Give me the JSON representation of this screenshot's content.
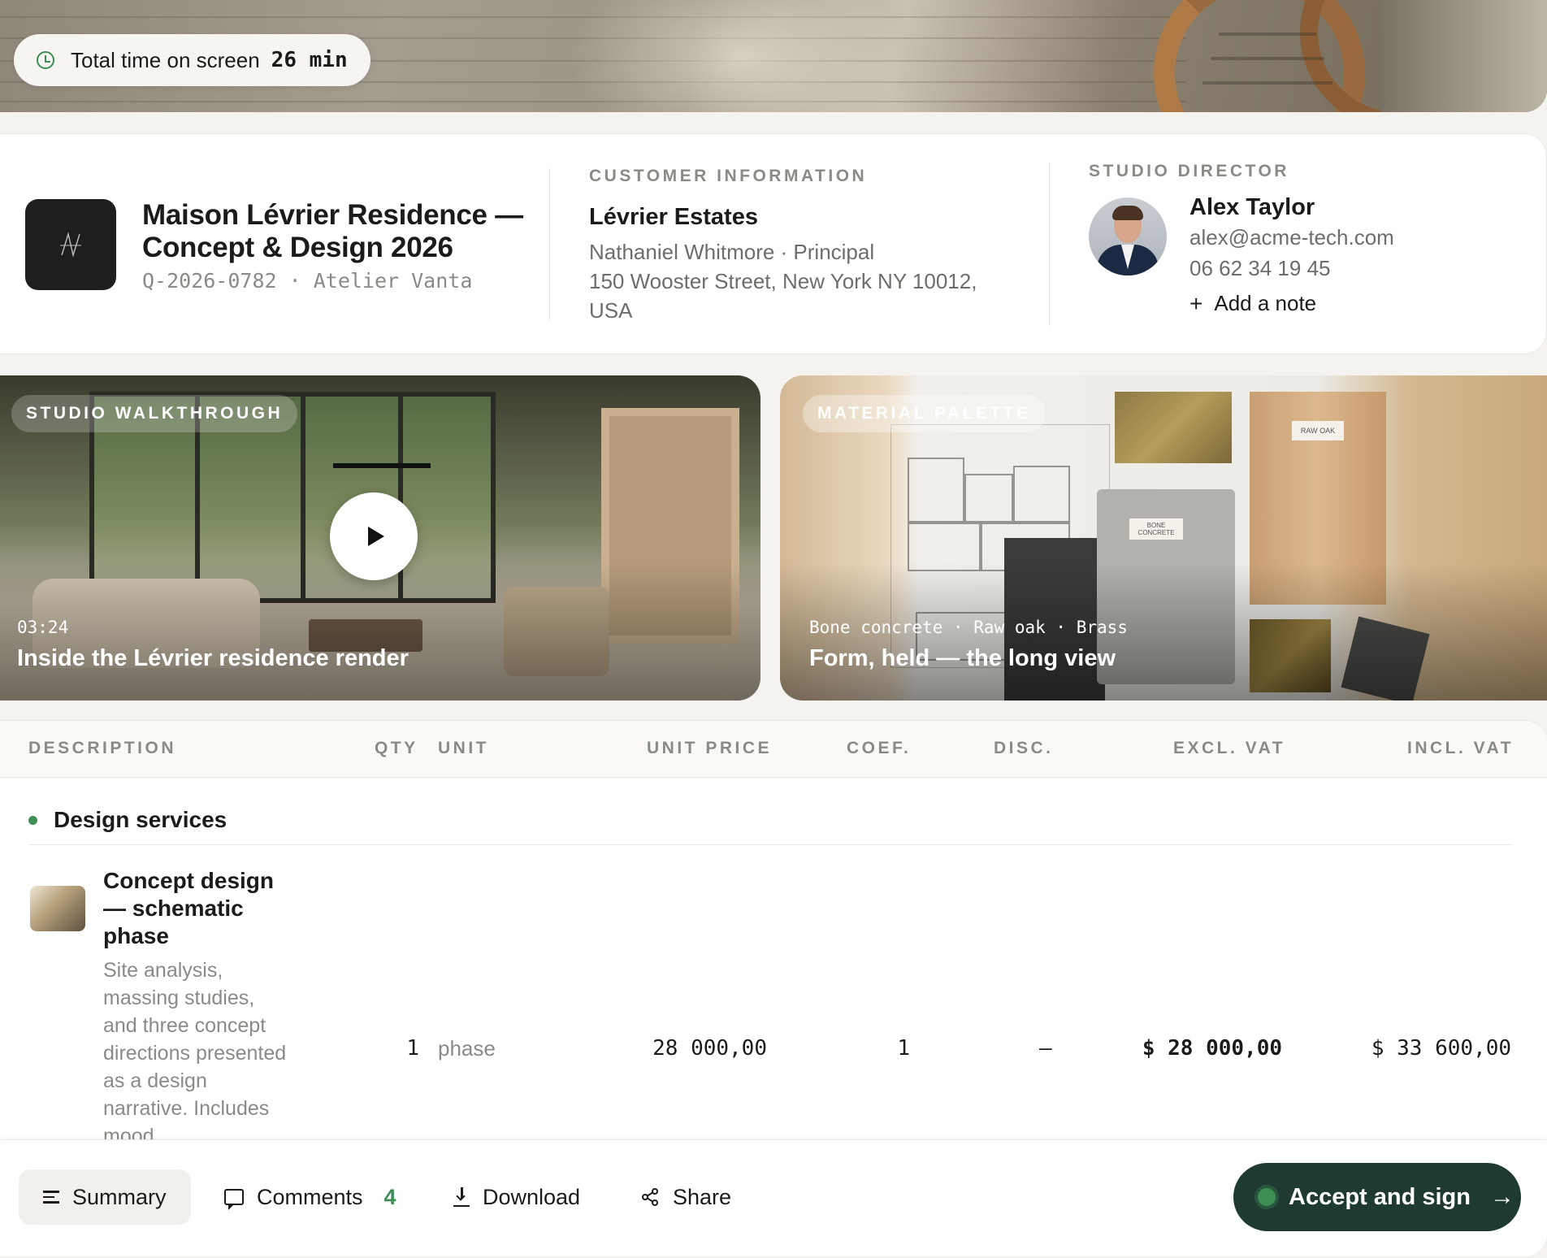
{
  "screen_timer": {
    "label": "Total time on screen",
    "value": "26 min"
  },
  "project": {
    "title": "Maison Lévrier Residence — Concept & Design 2026",
    "reference": "Q-2026-0782 · Atelier Vanta"
  },
  "customer": {
    "heading": "CUSTOMER INFORMATION",
    "company": "Lévrier Estates",
    "contact": "Nathaniel Whitmore · Principal",
    "address_line1": "150 Wooster Street, New York NY 10012,",
    "address_line2": "USA"
  },
  "director": {
    "heading": "STUDIO DIRECTOR",
    "name": "Alex Taylor",
    "email": "alex@acme-tech.com",
    "phone": "06 62 34 19 45",
    "add_note_label": "Add a note"
  },
  "media": [
    {
      "tag": "STUDIO WALKTHROUGH",
      "meta": "03:24",
      "title": "Inside the Lévrier residence render"
    },
    {
      "tag": "MATERIAL PALETTE",
      "meta": "Bone concrete · Raw oak · Brass",
      "title": "Form, held — the long view",
      "label_oak": "RAW OAK",
      "label_concrete": "BONE CONCRETE"
    }
  ],
  "table": {
    "columns": {
      "description": "DESCRIPTION",
      "qty": "QTY",
      "unit": "UNIT",
      "unit_price": "UNIT PRICE",
      "coef": "COEF.",
      "disc": "DISC.",
      "excl_vat": "EXCL. VAT",
      "incl_vat": "INCL. VAT"
    },
    "section": "Design services",
    "rows": [
      {
        "name": "Concept design — schematic phase",
        "description": "Site analysis, massing studies, and three concept directions presented as a design narrative. Includes mood",
        "qty": "1",
        "unit": "phase",
        "unit_price": "28 000,00",
        "coef": "1",
        "disc": "—",
        "excl_vat": "$ 28 000,00",
        "incl_vat": "$ 33 600,00"
      }
    ]
  },
  "actions": {
    "summary": "Summary",
    "comments": "Comments",
    "comments_count": "4",
    "download": "Download",
    "share": "Share",
    "accept": "Accept and sign"
  },
  "colors": {
    "accent": "#3b8f55",
    "primary_button": "#1f3a31",
    "background": "#f4f3ef"
  }
}
